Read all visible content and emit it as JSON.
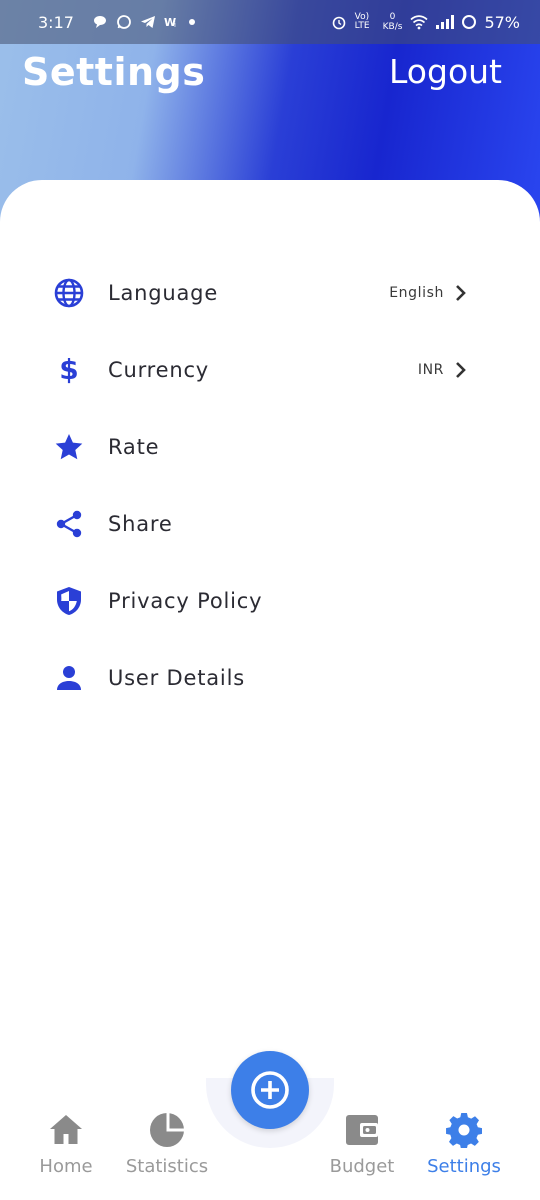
{
  "status_bar": {
    "time": "3:17",
    "left_icons": [
      "chat-bubble-icon",
      "whatsapp-icon",
      "telegram-icon",
      "wi-icon",
      "dot-icon"
    ],
    "network_label": "Vo) LTE",
    "speed_value": "0",
    "speed_unit": "KB/s",
    "battery": "57%"
  },
  "header": {
    "title": "Settings",
    "logout_label": "Logout"
  },
  "menu": {
    "items": [
      {
        "label": "Language",
        "value": "English",
        "icon": "globe-icon"
      },
      {
        "label": "Currency",
        "value": "INR",
        "icon": "dollar-icon"
      },
      {
        "label": "Rate",
        "icon": "star-icon"
      },
      {
        "label": "Share",
        "icon": "share-icon"
      },
      {
        "label": "Privacy Policy",
        "icon": "shield-icon"
      },
      {
        "label": "User Details",
        "icon": "person-icon"
      }
    ]
  },
  "bottom_nav": {
    "items": [
      {
        "label": "Home",
        "icon": "home-icon"
      },
      {
        "label": "Statistics",
        "icon": "pie-chart-icon"
      },
      {
        "label": "Budget",
        "icon": "wallet-icon"
      },
      {
        "label": "Settings",
        "icon": "gear-icon",
        "active": true
      }
    ],
    "fab_icon": "plus-circle-icon"
  },
  "colors": {
    "accent": "#3d7fe8",
    "icon_blue": "#2a3fd6",
    "inactive": "#9a9a9a"
  }
}
